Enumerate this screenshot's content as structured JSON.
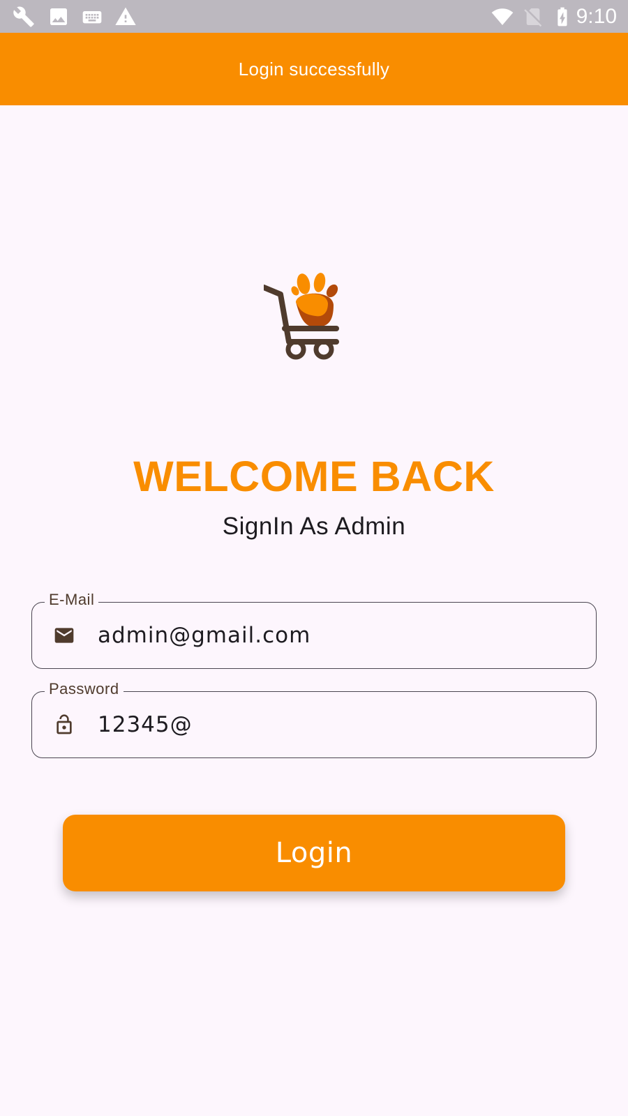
{
  "status_bar": {
    "time": "9:10",
    "left_icons": [
      "wrench-icon",
      "image-icon",
      "keyboard-icon",
      "warning-icon"
    ],
    "right_icons": [
      "wifi-icon",
      "no-sim-icon",
      "battery-charging-icon"
    ]
  },
  "snackbar": {
    "message": "Login successfully"
  },
  "login": {
    "title": "WELCOME BACK",
    "subtitle": "SignIn As Admin",
    "email_label": "E-Mail",
    "email_value": "admin@gmail.com",
    "password_label": "Password",
    "password_value": "12345@",
    "button_label": "Login"
  },
  "colors": {
    "accent": "#f98d00",
    "background": "#fdf6fd",
    "status_bar": "#bcb8bf",
    "icon_brown": "#4f3b2d"
  }
}
